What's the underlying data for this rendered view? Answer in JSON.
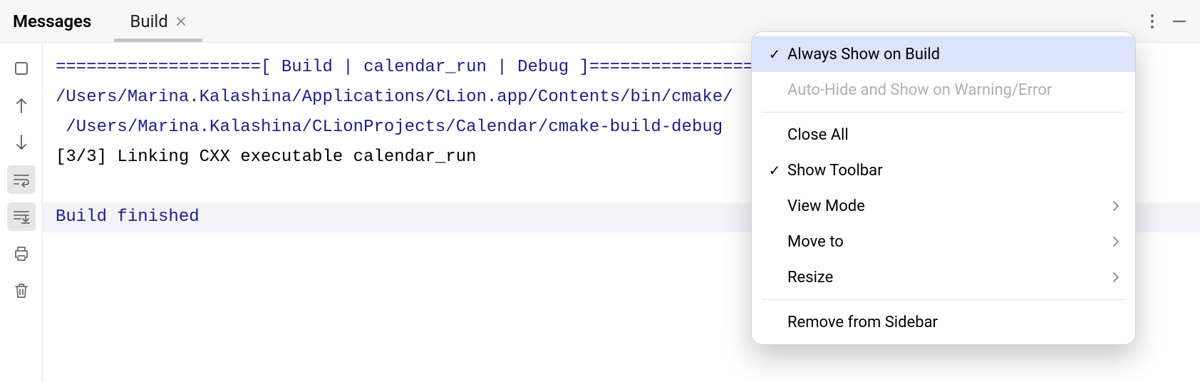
{
  "header": {
    "title": "Messages",
    "tab": {
      "label": "Build"
    }
  },
  "gutter": {
    "stop": "stop",
    "up": "up",
    "down": "down",
    "wrap": "wrap",
    "scroll_end": "scroll-end",
    "print": "print",
    "trash": "trash"
  },
  "console": {
    "line1": "====================[ Build | calendar_run | Debug ]====================",
    "line2": "/Users/Marina.Kalashina/Applications/CLion.app/Contents/bin/cmake/",
    "line3": " /Users/Marina.Kalashina/CLionProjects/Calendar/cmake-build-debug ",
    "line4": "[3/3] Linking CXX executable calendar_run",
    "line5": "",
    "line6": "Build finished"
  },
  "menu": {
    "always_show": "Always Show on Build",
    "auto_hide": "Auto-Hide and Show on Warning/Error",
    "close_all": "Close All",
    "show_toolbar": "Show Toolbar",
    "view_mode": "View Mode",
    "move_to": "Move to",
    "resize": "Resize",
    "remove": "Remove from Sidebar"
  }
}
